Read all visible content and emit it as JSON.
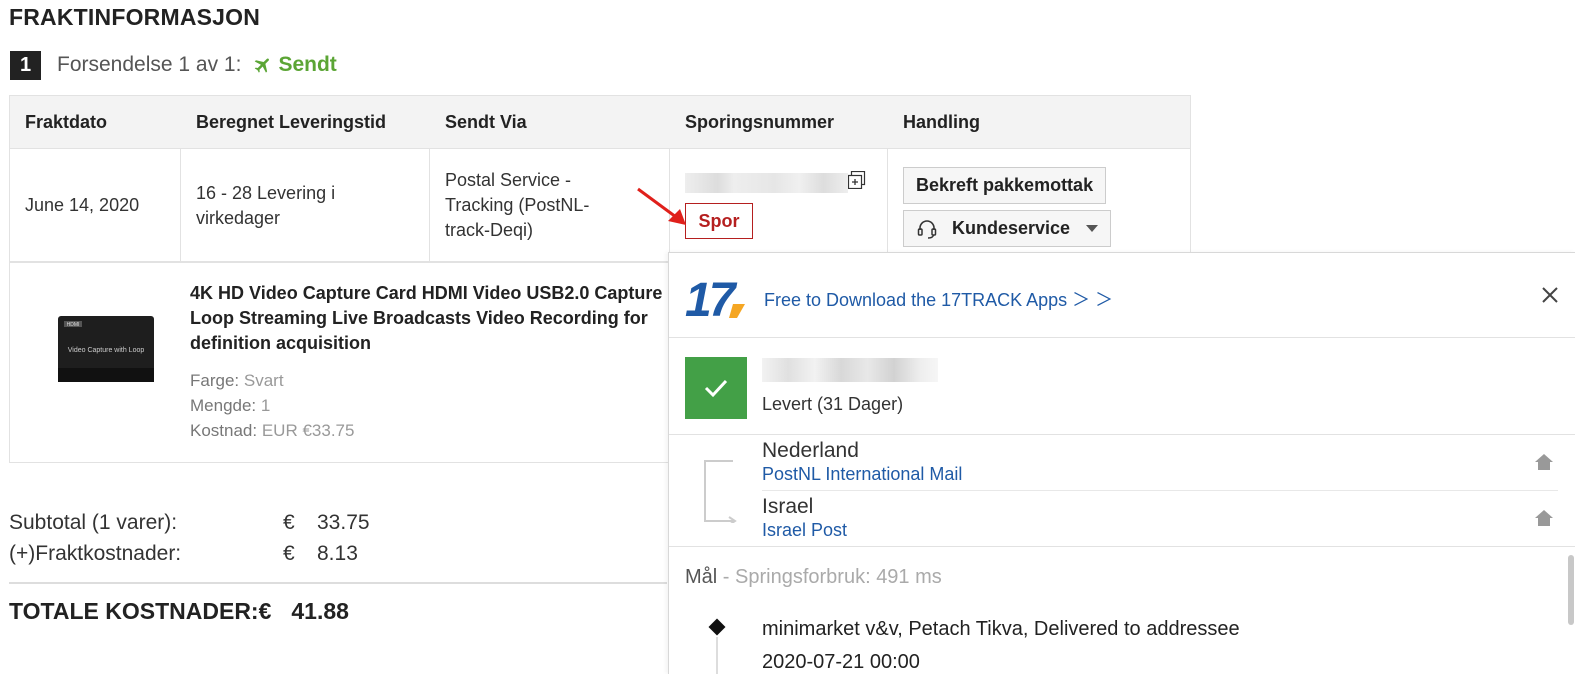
{
  "page": {
    "title": "FRAKTINFORMASJON"
  },
  "shipment": {
    "number": "1",
    "label": "Forsendelse 1 av 1:",
    "status": "Sendt",
    "status_color": "#5ba535"
  },
  "table": {
    "headers": [
      "Fraktdato",
      "Beregnet Leveringstid",
      "Sendt Via",
      "Sporingsnummer",
      "Handling"
    ],
    "row": {
      "ship_date": "June 14, 2020",
      "delivery_time": "16 - 28 Levering i virkedager",
      "shipped_via": "Postal Service - Tracking (PostNL-track-Deqi)",
      "track_button": "Spor",
      "confirm_button": "Bekreft pakkemottak",
      "support_button": "Kundeservice"
    }
  },
  "product": {
    "name": "4K HD Video Capture Card HDMI Video USB2.0 Capture Loop Streaming Live Broadcasts Video Recording for definition acquisition",
    "color_label": "Farge:",
    "color_value": "Svart",
    "qty_label": "Mengde:",
    "qty_value": "1",
    "cost_label": "Kostnad:",
    "cost_value": "EUR €33.75",
    "image_text": "Video Capture with Loop",
    "image_badge": "HDMI"
  },
  "totals": {
    "subtotal_label": "Subtotal (1 varer):",
    "subtotal_currency": "€",
    "subtotal_value": "33.75",
    "shipping_label": "(+)Fraktkostnader:",
    "shipping_currency": "€",
    "shipping_value": "8.13",
    "grand_label": "TOTALE KOSTNADER:€",
    "grand_value": "41.88"
  },
  "popup": {
    "logo_text": "17",
    "download_link": "Free to Download the 17TRACK Apps ＞ ＞",
    "status_text": "Levert (31 Dager)",
    "status_color": "#43a047",
    "route": [
      {
        "country": "Nederland",
        "carrier": "PostNL International Mail"
      },
      {
        "country": "Israel",
        "carrier": "Israel Post"
      }
    ],
    "destination_label": "Mål",
    "destination_sep": " - ",
    "destination_info": "Springsforbruk: 491 ms",
    "event_text": "minimarket v&v, Petach Tikva, Delivered to addressee",
    "event_time": "2020-07-21 00:00"
  },
  "icons": {
    "plane": "plane-icon",
    "copy": "copy-icon",
    "headset": "headset-icon",
    "close": "close-icon",
    "check": "check-icon",
    "home": "home-icon"
  },
  "colors": {
    "link": "#1f5aa6",
    "track_red": "#b51f1f",
    "logo_blue": "#1f5aa6",
    "logo_orange": "#f5a623"
  }
}
